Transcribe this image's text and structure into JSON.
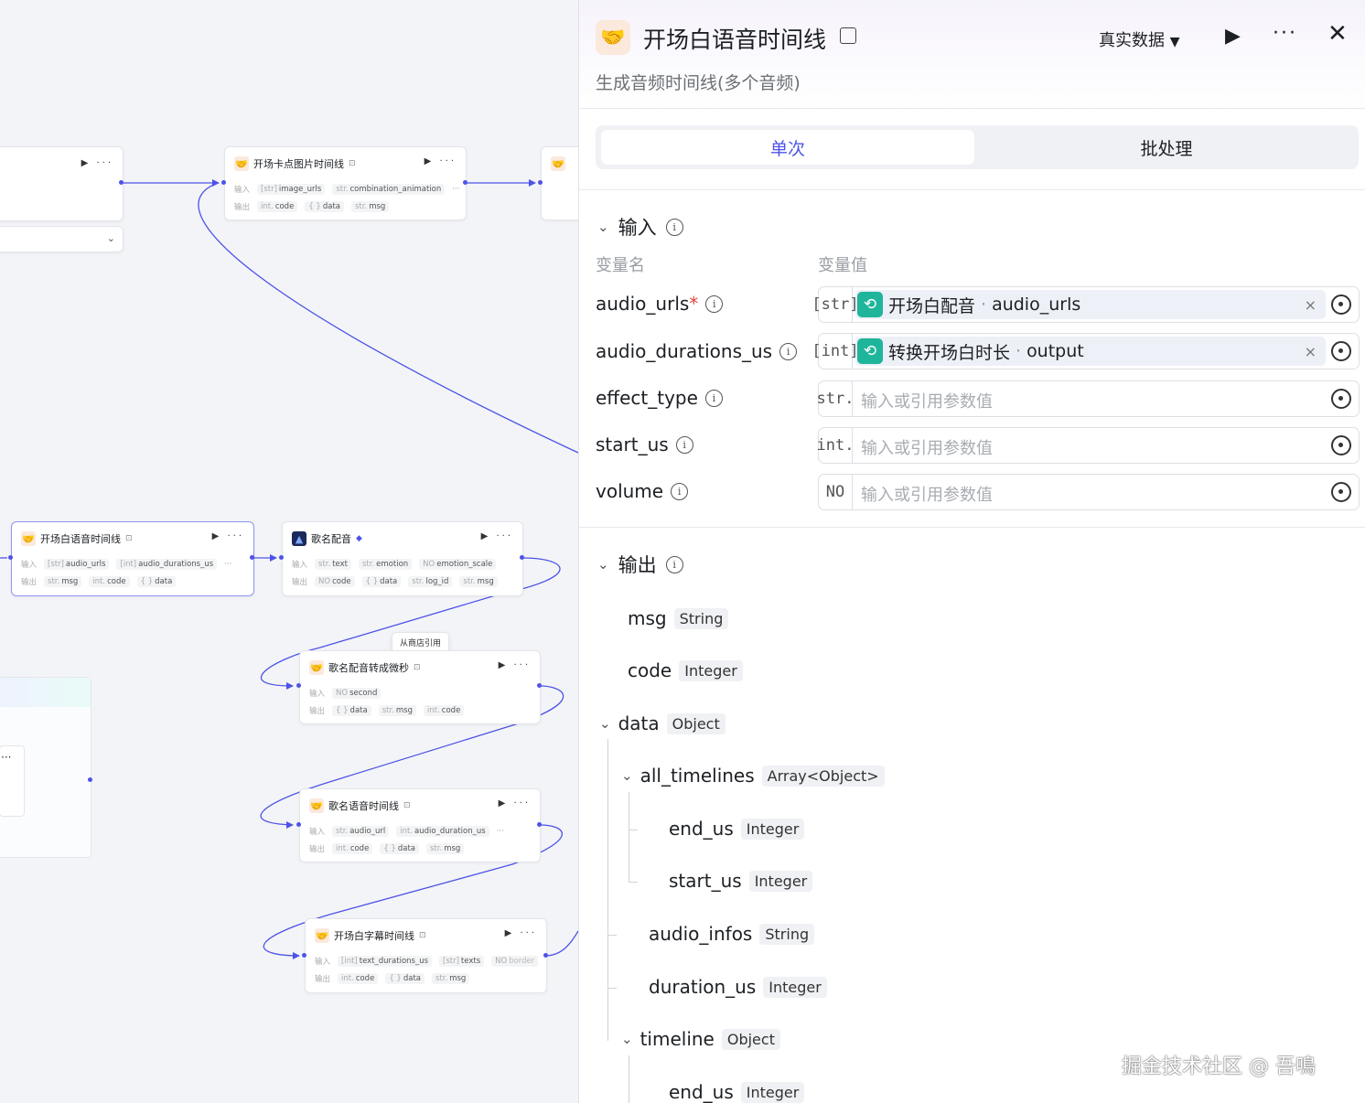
{
  "canvas": {
    "nodes": {
      "n1": {
        "title": "开场卡点图片时间线",
        "in_label": "输入",
        "out_label": "输出",
        "inputs": [
          {
            "t": "[str]",
            "n": "image_urls"
          },
          {
            "t": "str.",
            "n": "combination_animation"
          }
        ],
        "outputs": [
          {
            "t": "int.",
            "n": "code"
          },
          {
            "t": "{ }",
            "n": "data"
          },
          {
            "t": "str.",
            "n": "msg"
          }
        ]
      },
      "n2": {
        "title": "开场白语音时间线",
        "in_label": "输入",
        "out_label": "输出",
        "inputs": [
          {
            "t": "[str]",
            "n": "audio_urls"
          },
          {
            "t": "[int]",
            "n": "audio_durations_us"
          }
        ],
        "outputs": [
          {
            "t": "str.",
            "n": "msg"
          },
          {
            "t": "int.",
            "n": "code"
          },
          {
            "t": "{ }",
            "n": "data"
          }
        ]
      },
      "n3": {
        "title": "歌名配音",
        "in_label": "输入",
        "out_label": "输出",
        "inputs": [
          {
            "t": "str.",
            "n": "text"
          },
          {
            "t": "str.",
            "n": "emotion"
          },
          {
            "t": "NO",
            "n": "emotion_scale"
          }
        ],
        "outputs": [
          {
            "t": "NO",
            "n": "code"
          },
          {
            "t": "{ }",
            "n": "data"
          },
          {
            "t": "str.",
            "n": "log_id"
          },
          {
            "t": "str.",
            "n": "msg"
          }
        ]
      },
      "n4": {
        "title": "歌名配音转成微秒",
        "in_label": "输入",
        "out_label": "输出",
        "inputs": [
          {
            "t": "NO",
            "n": "second"
          }
        ],
        "outputs": [
          {
            "t": "{ }",
            "n": "data"
          },
          {
            "t": "str.",
            "n": "msg"
          },
          {
            "t": "int.",
            "n": "code"
          }
        ]
      },
      "n5": {
        "title": "歌名语音时间线",
        "in_label": "输入",
        "out_label": "输出",
        "inputs": [
          {
            "t": "str.",
            "n": "audio_url"
          },
          {
            "t": "int.",
            "n": "audio_duration_us"
          }
        ],
        "outputs": [
          {
            "t": "int.",
            "n": "code"
          },
          {
            "t": "{ }",
            "n": "data"
          },
          {
            "t": "str.",
            "n": "msg"
          }
        ]
      },
      "n6": {
        "title": "开场白字幕时间线",
        "in_label": "输入",
        "out_label": "输出",
        "inputs": [
          {
            "t": "[int]",
            "n": "text_durations_us"
          },
          {
            "t": "[str]",
            "n": "texts"
          },
          {
            "t": "NO",
            "n": "border"
          }
        ],
        "outputs": [
          {
            "t": "int.",
            "n": "code"
          },
          {
            "t": "{ }",
            "n": "data"
          },
          {
            "t": "str.",
            "n": "msg"
          }
        ]
      }
    },
    "tooltip": "从商店引用"
  },
  "panel": {
    "title": "开场白语音时间线",
    "description": "生成音频时间线(多个音频)",
    "data_mode": "真实数据",
    "tabs": {
      "single": "单次",
      "batch": "批处理"
    },
    "input_section": "输入",
    "col_name": "变量名",
    "col_value": "变量值",
    "inputs": [
      {
        "name": "audio_urls",
        "type": "[str]",
        "ref_node": "开场白配音",
        "ref_field": "audio_urls",
        "required": "*"
      },
      {
        "name": "audio_durations_us",
        "type": "[int]",
        "ref_node": "转换开场白时长",
        "ref_field": "output"
      },
      {
        "name": "effect_type",
        "type": "str.",
        "placeholder": "输入或引用参数值"
      },
      {
        "name": "start_us",
        "type": "int.",
        "placeholder": "输入或引用参数值"
      },
      {
        "name": "volume",
        "type": "NO",
        "placeholder": "输入或引用参数值"
      }
    ],
    "output_section": "输出",
    "outputs": [
      {
        "name": "msg",
        "type": "String"
      },
      {
        "name": "code",
        "type": "Integer"
      },
      {
        "name": "data",
        "type": "Object"
      },
      {
        "name": "all_timelines",
        "type": "Array<Object>"
      },
      {
        "name": "end_us",
        "type": "Integer"
      },
      {
        "name": "start_us",
        "type": "Integer"
      },
      {
        "name": "audio_infos",
        "type": "String"
      },
      {
        "name": "duration_us",
        "type": "Integer"
      },
      {
        "name": "timeline",
        "type": "Object"
      },
      {
        "name": "end_us",
        "type": "Integer"
      }
    ]
  },
  "watermark": "掘金技术社区 @ 吾鳴",
  "colors": {
    "accent": "#4d53e8",
    "ref_icon": "#1fb59b",
    "required": "#e0473b"
  }
}
